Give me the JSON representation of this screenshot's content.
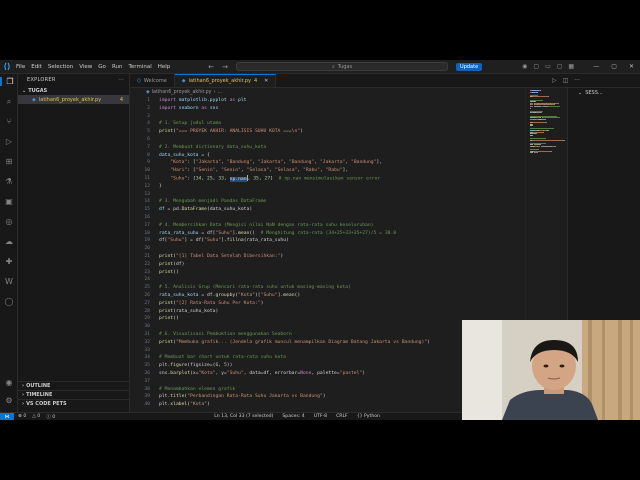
{
  "titlebar": {
    "menu": [
      "File",
      "Edit",
      "Selection",
      "View",
      "Go",
      "Run",
      "Terminal",
      "Help"
    ],
    "search_placeholder": "Tugas",
    "update_label": "Update"
  },
  "sidebar": {
    "title": "EXPLORER",
    "folder": "TUGAS",
    "file": "latihan6_proyek_akhir.py",
    "file_badge": "4",
    "outline": "OUTLINE",
    "timeline": "TIMELINE",
    "vscode_pets": "VS CODE PETS"
  },
  "tabs": [
    {
      "label": "Welcome",
      "active": false
    },
    {
      "label": "latihan6_proyek_akhir.py",
      "badge": "4",
      "active": true
    }
  ],
  "breadcrumb": [
    "latihan6_proyek_akhir.py",
    "..."
  ],
  "right_panel": {
    "title": "SESS..."
  },
  "status": {
    "errors": "0",
    "warnings": "0",
    "info": "0",
    "position": "Ln 13, Col 33 (7 selected)",
    "spaces": "Spaces: 4",
    "encoding": "UTF-8",
    "eol": "CRLF",
    "language": "Python"
  },
  "editor": {
    "lines": [
      {
        "n": "1",
        "tokens": [
          {
            "t": "import",
            "c": "keyword"
          },
          {
            "t": " matplotlib.pyplot ",
            "c": "var"
          },
          {
            "t": "as",
            "c": "keyword"
          },
          {
            "t": " plt",
            "c": "var"
          }
        ]
      },
      {
        "n": "2",
        "tokens": [
          {
            "t": "import",
            "c": "keyword"
          },
          {
            "t": " seaborn ",
            "c": "var"
          },
          {
            "t": "as",
            "c": "keyword"
          },
          {
            "t": " sns",
            "c": "var"
          }
        ]
      },
      {
        "n": "3",
        "tokens": []
      },
      {
        "n": "4",
        "tokens": [
          {
            "t": "# 1. Setup judul utama",
            "c": "comment"
          }
        ]
      },
      {
        "n": "5",
        "tokens": [
          {
            "t": "print",
            "c": "func"
          },
          {
            "t": "(",
            "c": "default"
          },
          {
            "t": "\"=== PROYEK AKHIR: ANALISIS SUHU KOTA ===\\n\"",
            "c": "string"
          },
          {
            "t": ")",
            "c": "default"
          }
        ]
      },
      {
        "n": "6",
        "tokens": []
      },
      {
        "n": "7",
        "tokens": [
          {
            "t": "# 2. Membuat dictionary data_suhu_kota",
            "c": "comment"
          }
        ]
      },
      {
        "n": "8",
        "tokens": [
          {
            "t": "data_suhu_kota",
            "c": "var"
          },
          {
            "t": " = {",
            "c": "default"
          }
        ]
      },
      {
        "n": "9",
        "tokens": [
          {
            "t": "    ",
            "c": "default"
          },
          {
            "t": "\"Kota\"",
            "c": "string"
          },
          {
            "t": ": [",
            "c": "default"
          },
          {
            "t": "\"Jakarta\"",
            "c": "string"
          },
          {
            "t": ", ",
            "c": "default"
          },
          {
            "t": "\"Bandung\"",
            "c": "string"
          },
          {
            "t": ", ",
            "c": "default"
          },
          {
            "t": "\"Jakarta\"",
            "c": "string"
          },
          {
            "t": ", ",
            "c": "default"
          },
          {
            "t": "\"Bandung\"",
            "c": "string"
          },
          {
            "t": ", ",
            "c": "default"
          },
          {
            "t": "\"Jakarta\"",
            "c": "string"
          },
          {
            "t": ", ",
            "c": "default"
          },
          {
            "t": "\"Bandung\"",
            "c": "string"
          },
          {
            "t": "],",
            "c": "default"
          }
        ]
      },
      {
        "n": "10",
        "tokens": [
          {
            "t": "    ",
            "c": "default"
          },
          {
            "t": "\"Hari\"",
            "c": "string"
          },
          {
            "t": ": [",
            "c": "default"
          },
          {
            "t": "\"Senin\"",
            "c": "string"
          },
          {
            "t": ", ",
            "c": "default"
          },
          {
            "t": "\"Senin\"",
            "c": "string"
          },
          {
            "t": ", ",
            "c": "default"
          },
          {
            "t": "\"Selasa\"",
            "c": "string"
          },
          {
            "t": ", ",
            "c": "default"
          },
          {
            "t": "\"Selasa\"",
            "c": "string"
          },
          {
            "t": ", ",
            "c": "default"
          },
          {
            "t": "\"Rabu\"",
            "c": "string"
          },
          {
            "t": ", ",
            "c": "default"
          },
          {
            "t": "\"Rabu\"",
            "c": "string"
          },
          {
            "t": "],",
            "c": "default"
          }
        ]
      },
      {
        "n": "11",
        "tokens": [
          {
            "t": "    ",
            "c": "default"
          },
          {
            "t": "\"Suhu\"",
            "c": "string"
          },
          {
            "t": ": [",
            "c": "default"
          },
          {
            "t": "34",
            "c": "number"
          },
          {
            "t": ", ",
            "c": "default"
          },
          {
            "t": "25",
            "c": "number"
          },
          {
            "t": ", ",
            "c": "default"
          },
          {
            "t": "33",
            "c": "number"
          },
          {
            "t": ", ",
            "c": "default"
          },
          {
            "t": "np.nan",
            "c": "sel"
          },
          {
            "t": "|",
            "c": "cursor"
          },
          {
            "t": ", ",
            "c": "default"
          },
          {
            "t": "35",
            "c": "number"
          },
          {
            "t": ", ",
            "c": "default"
          },
          {
            "t": "27",
            "c": "number"
          },
          {
            "t": "]  ",
            "c": "default"
          },
          {
            "t": "# np.nan mensimulasikan sensor error",
            "c": "comment"
          }
        ]
      },
      {
        "n": "12",
        "tokens": [
          {
            "t": "}",
            "c": "default"
          }
        ]
      },
      {
        "n": "13",
        "tokens": []
      },
      {
        "n": "14",
        "tokens": [
          {
            "t": "# 3. Mengubah menjadi Pandas DataFrame",
            "c": "comment"
          }
        ]
      },
      {
        "n": "15",
        "tokens": [
          {
            "t": "df",
            "c": "var"
          },
          {
            "t": " = pd.",
            "c": "default"
          },
          {
            "t": "DataFrame",
            "c": "func"
          },
          {
            "t": "(data_suhu_kota)",
            "c": "default"
          }
        ]
      },
      {
        "n": "16",
        "tokens": []
      },
      {
        "n": "17",
        "tokens": [
          {
            "t": "# 4. Membersihkan Data (Mengisi nilai NaN dengan rata-rata suhu keseluruhan)",
            "c": "comment"
          }
        ]
      },
      {
        "n": "18",
        "tokens": [
          {
            "t": "rata_rata_suhu",
            "c": "var"
          },
          {
            "t": " = df[",
            "c": "default"
          },
          {
            "t": "\"Suhu\"",
            "c": "string"
          },
          {
            "t": "].",
            "c": "default"
          },
          {
            "t": "mean",
            "c": "func"
          },
          {
            "t": "()  ",
            "c": "default"
          },
          {
            "t": "# Menghitung rata-rata (34+25+33+35+27)/5 = 30.8",
            "c": "comment"
          }
        ]
      },
      {
        "n": "19",
        "tokens": [
          {
            "t": "df[",
            "c": "default"
          },
          {
            "t": "\"Suhu\"",
            "c": "string"
          },
          {
            "t": "] = df[",
            "c": "default"
          },
          {
            "t": "\"Suhu\"",
            "c": "string"
          },
          {
            "t": "].",
            "c": "default"
          },
          {
            "t": "fillna",
            "c": "func"
          },
          {
            "t": "(rata_rata_suhu)",
            "c": "default"
          }
        ]
      },
      {
        "n": "20",
        "tokens": []
      },
      {
        "n": "21",
        "tokens": [
          {
            "t": "print",
            "c": "func"
          },
          {
            "t": "(",
            "c": "default"
          },
          {
            "t": "\"[1] Tabel Data Setelah Dibersihkan:\"",
            "c": "string"
          },
          {
            "t": ")",
            "c": "default"
          }
        ]
      },
      {
        "n": "22",
        "tokens": [
          {
            "t": "print",
            "c": "func"
          },
          {
            "t": "(df)",
            "c": "default"
          }
        ]
      },
      {
        "n": "23",
        "tokens": [
          {
            "t": "print",
            "c": "func"
          },
          {
            "t": "()",
            "c": "default"
          }
        ]
      },
      {
        "n": "24",
        "tokens": []
      },
      {
        "n": "25",
        "tokens": [
          {
            "t": "# 5. Analisis Grup (Mencari rata-rata suhu untuk masing-masing kota)",
            "c": "comment"
          }
        ]
      },
      {
        "n": "26",
        "tokens": [
          {
            "t": "rata_suhu_kota",
            "c": "var"
          },
          {
            "t": " = df.",
            "c": "default"
          },
          {
            "t": "groupby",
            "c": "func"
          },
          {
            "t": "(",
            "c": "default"
          },
          {
            "t": "\"Kota\"",
            "c": "string"
          },
          {
            "t": ")[",
            "c": "default"
          },
          {
            "t": "\"Suhu\"",
            "c": "string"
          },
          {
            "t": "].",
            "c": "default"
          },
          {
            "t": "mean",
            "c": "func"
          },
          {
            "t": "()",
            "c": "default"
          }
        ]
      },
      {
        "n": "27",
        "tokens": [
          {
            "t": "print",
            "c": "func"
          },
          {
            "t": "(",
            "c": "default"
          },
          {
            "t": "\"[2] Rata-Rata Suhu Per Kota:\"",
            "c": "string"
          },
          {
            "t": ")",
            "c": "default"
          }
        ]
      },
      {
        "n": "28",
        "tokens": [
          {
            "t": "print",
            "c": "func"
          },
          {
            "t": "(rata_suhu_kota)",
            "c": "default"
          }
        ]
      },
      {
        "n": "29",
        "tokens": [
          {
            "t": "print",
            "c": "func"
          },
          {
            "t": "()",
            "c": "default"
          }
        ]
      },
      {
        "n": "30",
        "tokens": []
      },
      {
        "n": "31",
        "tokens": [
          {
            "t": "# 6. Visualisasi Pembuktian menggunakan Seaborn",
            "c": "comment"
          }
        ]
      },
      {
        "n": "32",
        "tokens": [
          {
            "t": "print",
            "c": "func"
          },
          {
            "t": "(",
            "c": "default"
          },
          {
            "t": "\"Membuka grafik... (Jendela grafik muncul menampilkan Diagram Batang Jakarta vs Bandung)\"",
            "c": "string"
          },
          {
            "t": ")",
            "c": "default"
          }
        ]
      },
      {
        "n": "33",
        "tokens": []
      },
      {
        "n": "34",
        "tokens": [
          {
            "t": "# Membuat bar chart untuk rata-rata suhu kota",
            "c": "comment"
          }
        ]
      },
      {
        "n": "35",
        "tokens": [
          {
            "t": "plt.",
            "c": "default"
          },
          {
            "t": "figure",
            "c": "func"
          },
          {
            "t": "(figsize=(",
            "c": "default"
          },
          {
            "t": "6",
            "c": "number"
          },
          {
            "t": ", ",
            "c": "default"
          },
          {
            "t": "5",
            "c": "number"
          },
          {
            "t": "))",
            "c": "default"
          }
        ]
      },
      {
        "n": "36",
        "tokens": [
          {
            "t": "sns.",
            "c": "default"
          },
          {
            "t": "barplot",
            "c": "func"
          },
          {
            "t": "(x=",
            "c": "default"
          },
          {
            "t": "\"Kota\"",
            "c": "string"
          },
          {
            "t": ", y=",
            "c": "default"
          },
          {
            "t": "\"Suhu\"",
            "c": "string"
          },
          {
            "t": ", data=df, errorbar=",
            "c": "default"
          },
          {
            "t": "None",
            "c": "keyword"
          },
          {
            "t": ", palette=",
            "c": "default"
          },
          {
            "t": "\"pastel\"",
            "c": "string"
          },
          {
            "t": ")",
            "c": "default"
          }
        ]
      },
      {
        "n": "37",
        "tokens": []
      },
      {
        "n": "38",
        "tokens": [
          {
            "t": "# Menambahkan elemen grafik",
            "c": "comment"
          }
        ]
      },
      {
        "n": "39",
        "tokens": [
          {
            "t": "plt.",
            "c": "default"
          },
          {
            "t": "title",
            "c": "func"
          },
          {
            "t": "(",
            "c": "default"
          },
          {
            "t": "\"Perbandingan Rata-Rata Suhu Jakarta vs Bandung\"",
            "c": "string"
          },
          {
            "t": ")",
            "c": "default"
          }
        ]
      },
      {
        "n": "40",
        "tokens": [
          {
            "t": "plt.",
            "c": "default"
          },
          {
            "t": "xlabel",
            "c": "func"
          },
          {
            "t": "(",
            "c": "default"
          },
          {
            "t": "\"Kota\"",
            "c": "string"
          },
          {
            "t": ")",
            "c": "default"
          }
        ]
      }
    ]
  },
  "colors": {
    "accent": "#0078d4",
    "update_button": "#0e63bd",
    "modified_file": "#e0c05a",
    "editor_bg": "#1e1e1e"
  }
}
